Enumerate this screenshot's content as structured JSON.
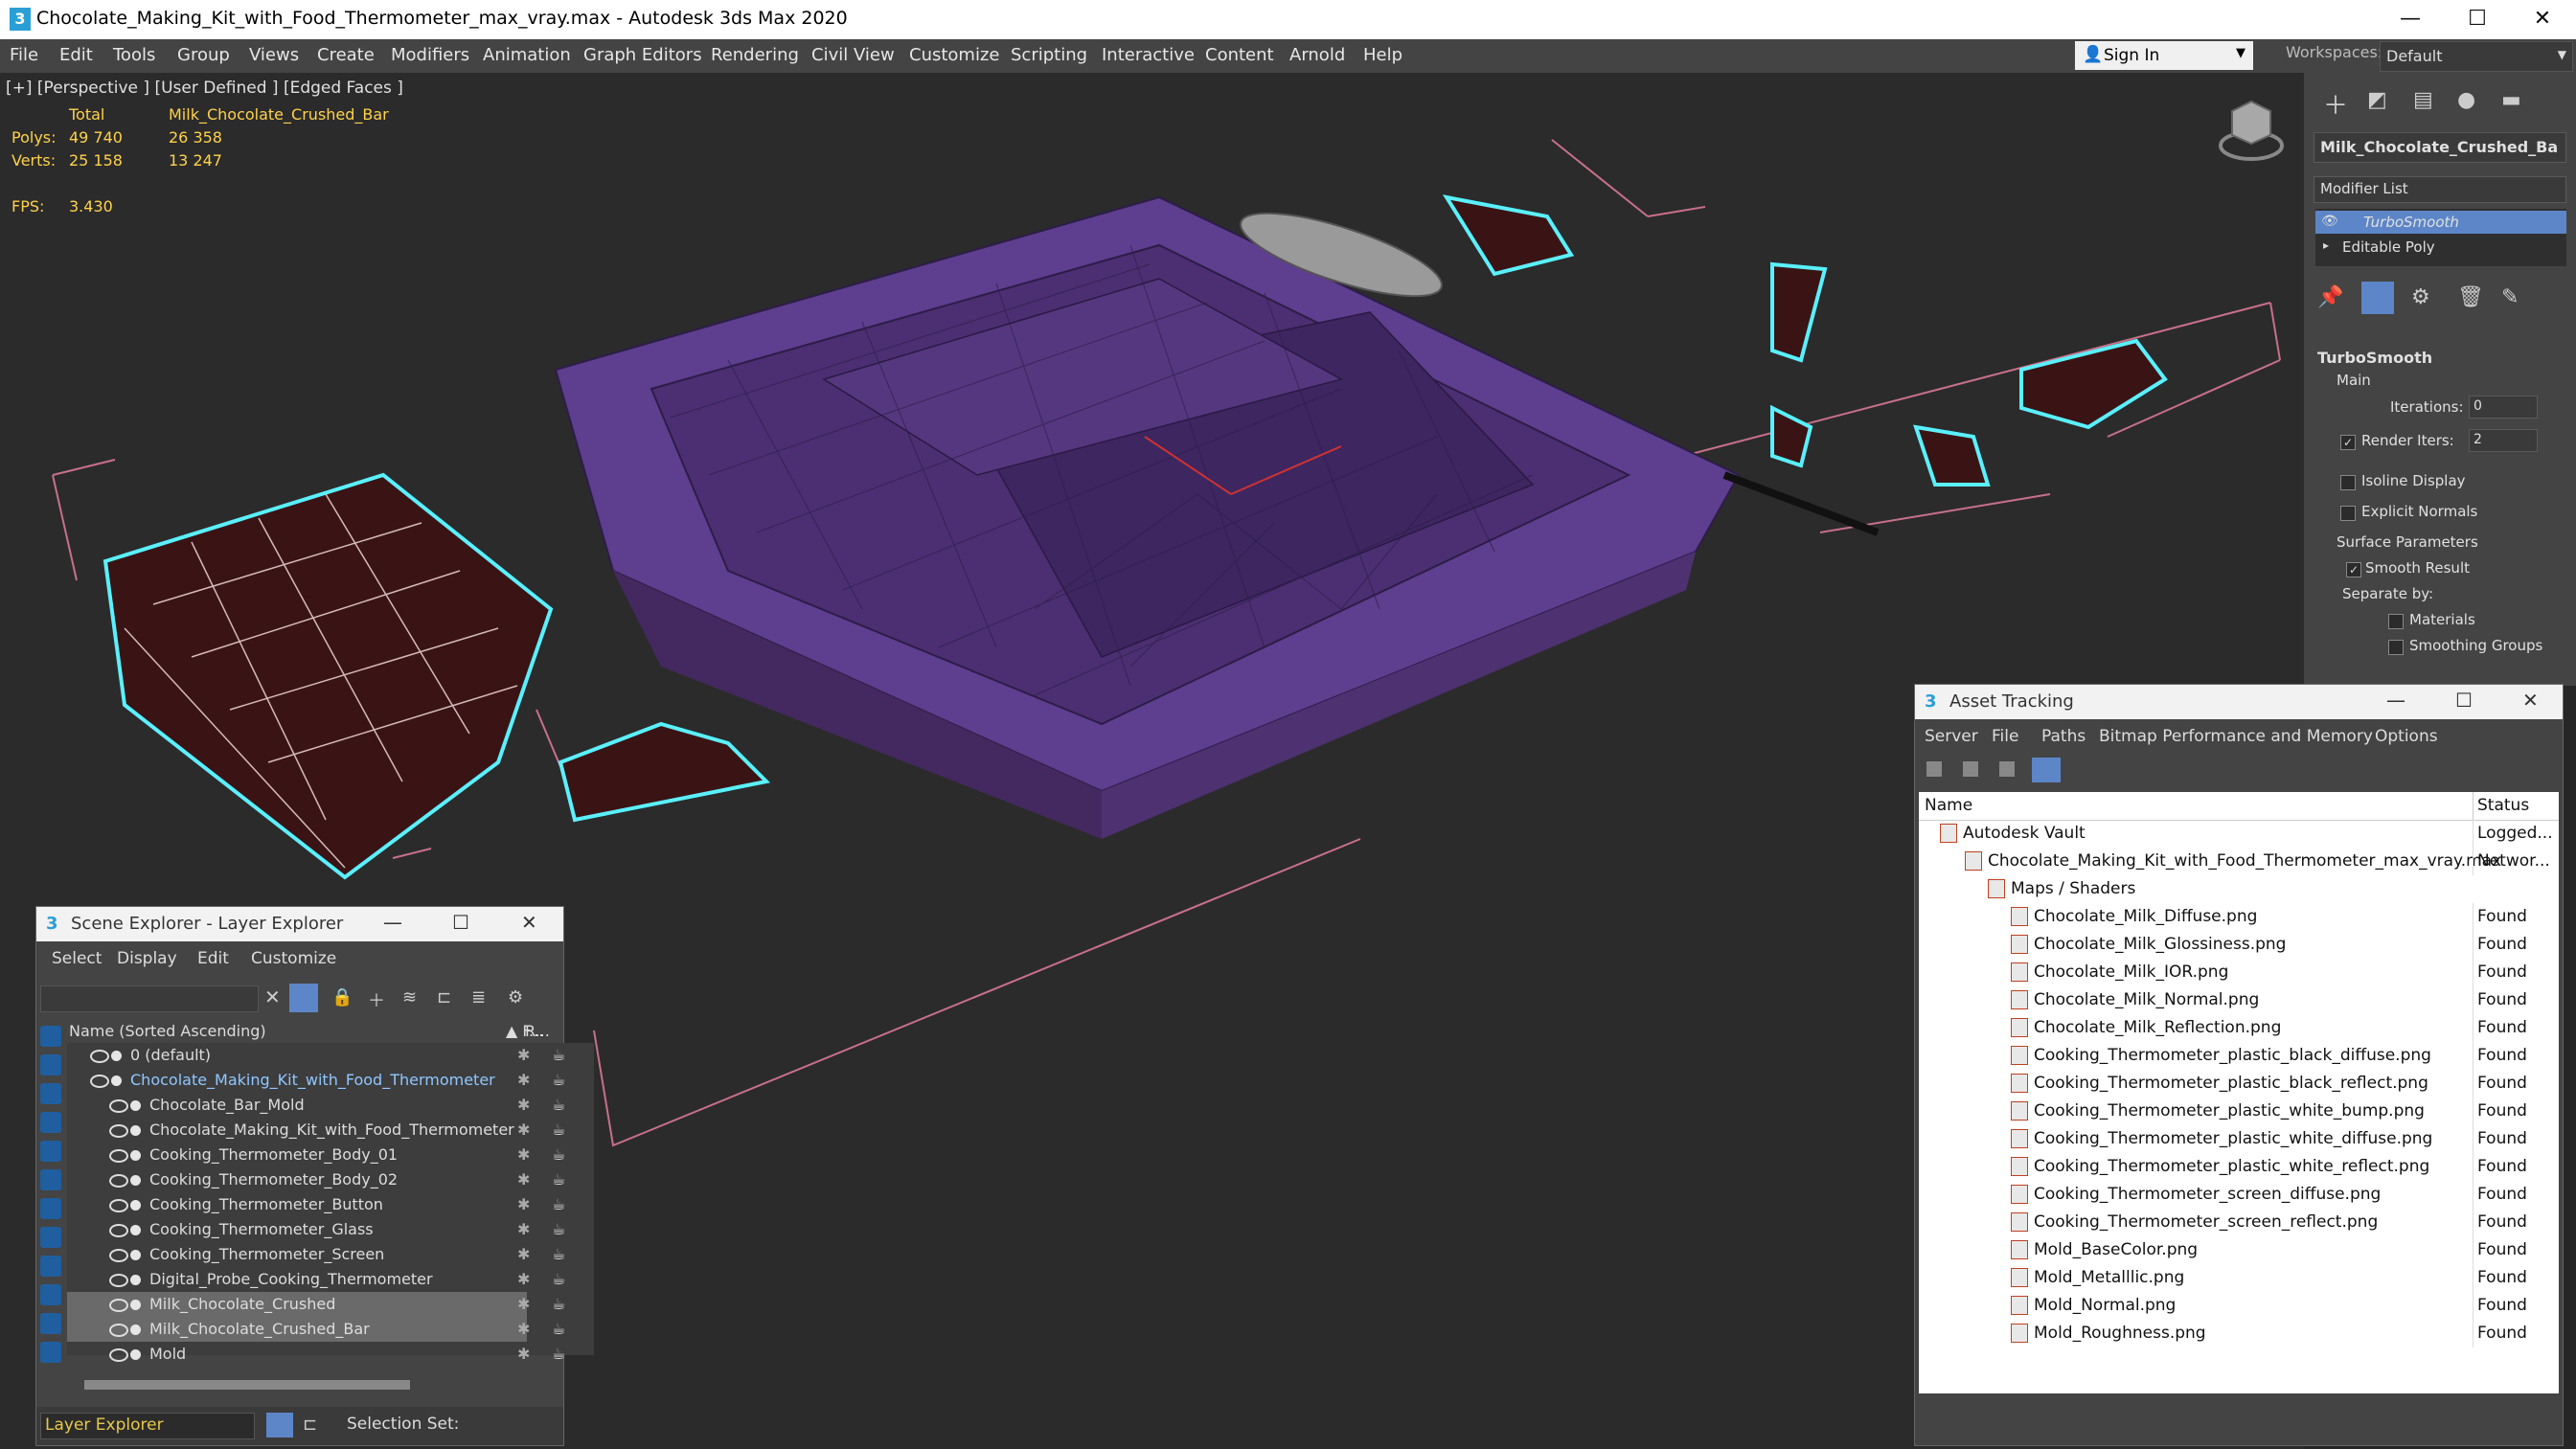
{
  "window": {
    "title": "Chocolate_Making_Kit_with_Food_Thermometer_max_vray.max - Autodesk 3ds Max 2020",
    "minimize": "—",
    "maximize": "☐",
    "close": "✕"
  },
  "menu": [
    "File",
    "Edit",
    "Tools",
    "Group",
    "Views",
    "Create",
    "Modifiers",
    "Animation",
    "Graph Editors",
    "Rendering",
    "Civil View",
    "Customize",
    "Scripting",
    "Interactive",
    "Content",
    "Arnold",
    "Help"
  ],
  "signin": {
    "label": "Sign In"
  },
  "workspace": {
    "label": "Workspaces:",
    "value": "Default"
  },
  "viewport": {
    "label": "[+] [Perspective ] [User Defined ] [Edged Faces ]",
    "stats_header_total": "Total",
    "stats_header_object": "Milk_Chocolate_Crushed_Bar",
    "polys_label": "Polys:",
    "polys_total": "49 740",
    "polys_object": "26 358",
    "verts_label": "Verts:",
    "verts_total": "25 158",
    "verts_object": "13 247",
    "fps_label": "FPS:",
    "fps_value": "3.430"
  },
  "command_panel": {
    "object_name": "Milk_Chocolate_Crushed_Ba",
    "modifier_list": "Modifier List",
    "stack": [
      "TurboSmooth",
      "Editable Poly"
    ],
    "rollout_title": "TurboSmooth",
    "main_label": "Main",
    "iterations_label": "Iterations:",
    "iterations_value": "0",
    "render_iters_label": "Render Iters:",
    "render_iters_value": "2",
    "isoline": "Isoline Display",
    "explicit_normals": "Explicit Normals",
    "surface_params": "Surface Parameters",
    "smooth_result": "Smooth Result",
    "separate_by": "Separate by:",
    "materials": "Materials",
    "smoothing_groups": "Smoothing Groups"
  },
  "asset_tracking": {
    "title": "Asset Tracking",
    "menu": [
      "Server",
      "File",
      "Paths",
      "Bitmap Performance and Memory",
      "Options"
    ],
    "col_name": "Name",
    "col_status": "Status",
    "rows": [
      {
        "name": "Autodesk Vault",
        "status": "Logged..."
      },
      {
        "name": "Chocolate_Making_Kit_with_Food_Thermometer_max_vray.max",
        "status": "Networ..."
      },
      {
        "name": "Maps / Shaders",
        "status": ""
      },
      {
        "name": "Chocolate_Milk_Diffuse.png",
        "status": "Found"
      },
      {
        "name": "Chocolate_Milk_Glossiness.png",
        "status": "Found"
      },
      {
        "name": "Chocolate_Milk_IOR.png",
        "status": "Found"
      },
      {
        "name": "Chocolate_Milk_Normal.png",
        "status": "Found"
      },
      {
        "name": "Chocolate_Milk_Reflection.png",
        "status": "Found"
      },
      {
        "name": "Cooking_Thermometer_plastic_black_diffuse.png",
        "status": "Found"
      },
      {
        "name": "Cooking_Thermometer_plastic_black_reflect.png",
        "status": "Found"
      },
      {
        "name": "Cooking_Thermometer_plastic_white_bump.png",
        "status": "Found"
      },
      {
        "name": "Cooking_Thermometer_plastic_white_diffuse.png",
        "status": "Found"
      },
      {
        "name": "Cooking_Thermometer_plastic_white_reflect.png",
        "status": "Found"
      },
      {
        "name": "Cooking_Thermometer_screen_diffuse.png",
        "status": "Found"
      },
      {
        "name": "Cooking_Thermometer_screen_reflect.png",
        "status": "Found"
      },
      {
        "name": "Mold_BaseColor.png",
        "status": "Found"
      },
      {
        "name": "Mold_Metalllic.png",
        "status": "Found"
      },
      {
        "name": "Mold_Normal.png",
        "status": "Found"
      },
      {
        "name": "Mold_Roughness.png",
        "status": "Found"
      }
    ]
  },
  "scene_explorer": {
    "title": "Scene Explorer - Layer Explorer",
    "menu": [
      "Select",
      "Display",
      "Edit",
      "Customize"
    ],
    "col_name": "Name (Sorted Ascending)",
    "col_f": "▲ F...",
    "col_r": "R...",
    "rows": [
      {
        "name": "0 (default)"
      },
      {
        "name": "Chocolate_Making_Kit_with_Food_Thermometer"
      },
      {
        "name": "Chocolate_Bar_Mold"
      },
      {
        "name": "Chocolate_Making_Kit_with_Food_Thermometer"
      },
      {
        "name": "Cooking_Thermometer_Body_01"
      },
      {
        "name": "Cooking_Thermometer_Body_02"
      },
      {
        "name": "Cooking_Thermometer_Button"
      },
      {
        "name": "Cooking_Thermometer_Glass"
      },
      {
        "name": "Cooking_Thermometer_Screen"
      },
      {
        "name": "Digital_Probe_Cooking_Thermometer"
      },
      {
        "name": "Milk_Chocolate_Crushed"
      },
      {
        "name": "Milk_Chocolate_Crushed_Bar"
      },
      {
        "name": "Mold"
      }
    ],
    "footer_label": "Layer Explorer",
    "selection_set": "Selection Set:"
  }
}
